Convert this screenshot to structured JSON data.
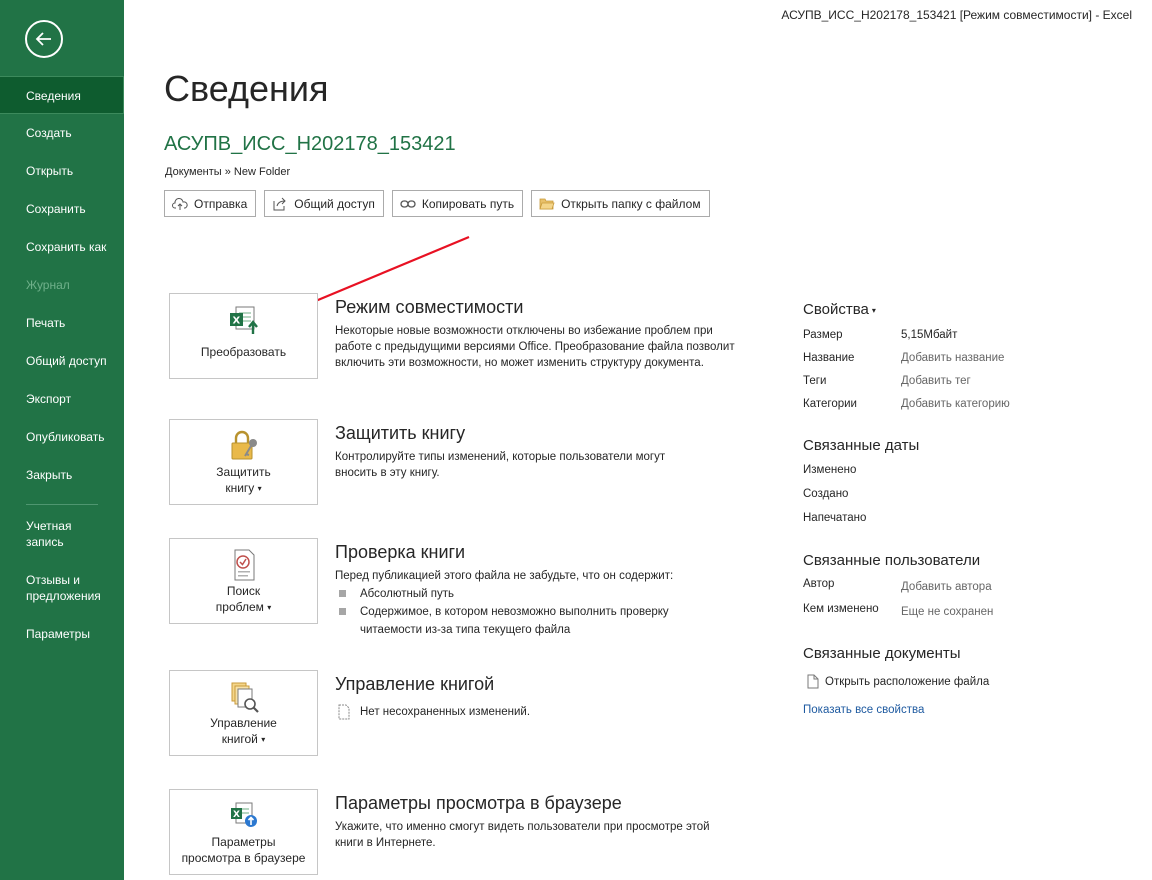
{
  "window": {
    "title": "АСУПВ_ИСС_Н202178_153421  [Режим совместимости]  -  Excel"
  },
  "sidebar": {
    "items": [
      {
        "label": "Сведения"
      },
      {
        "label": "Создать"
      },
      {
        "label": "Открыть"
      },
      {
        "label": "Сохранить"
      },
      {
        "label": "Сохранить как"
      },
      {
        "label": "Журнал"
      },
      {
        "label": "Печать"
      },
      {
        "label": "Общий доступ"
      },
      {
        "label": "Экспорт"
      },
      {
        "label": "Опубликовать"
      },
      {
        "label": "Закрыть"
      }
    ],
    "account": {
      "line1": "Учетная",
      "line2": "запись"
    },
    "feedback": {
      "line1": "Отзывы и",
      "line2": "предложения"
    },
    "options": "Параметры"
  },
  "header": {
    "title": "Сведения",
    "file_name": "АСУПВ_ИСС_Н202178_153421",
    "breadcrumb": "Документы » New Folder",
    "buttons": {
      "upload": "Отправка",
      "share": "Общий доступ",
      "copy_path": "Копировать путь",
      "open_folder": "Открыть папку с файлом"
    }
  },
  "sections": {
    "compat": {
      "button": "Преобразовать",
      "title": "Режим совместимости",
      "desc": "Некоторые новые возможности отключены во избежание проблем при работе с предыдущими версиями Office. Преобразование файла позволит включить эти возможности, но может изменить структуру документа."
    },
    "protect": {
      "button_line1": "Защитить",
      "button_line2": "книгу",
      "title": "Защитить книгу",
      "desc": "Контролируйте типы изменений, которые пользователи могут вносить в эту книгу."
    },
    "inspect": {
      "button_line1": "Поиск",
      "button_line2": "проблем",
      "title": "Проверка книги",
      "desc": "Перед публикацией этого файла не забудьте, что он содержит:",
      "bullets": [
        "Абсолютный путь",
        "Содержимое, в котором невозможно выполнить проверку читаемости из-за типа текущего файла"
      ]
    },
    "manage": {
      "button_line1": "Управление",
      "button_line2": "книгой",
      "title": "Управление книгой",
      "status": "Нет несохраненных изменений."
    },
    "browser": {
      "button_line1": "Параметры",
      "button_line2": "просмотра в браузере",
      "title": "Параметры просмотра в браузере",
      "desc": "Укажите, что именно смогут видеть пользователи при просмотре этой книги в Интернете."
    }
  },
  "properties": {
    "title": "Свойства",
    "rows": [
      {
        "label": "Размер",
        "value": "5,15Мбайт"
      },
      {
        "label": "Название",
        "value": "Добавить название"
      },
      {
        "label": "Теги",
        "value": "Добавить тег"
      },
      {
        "label": "Категории",
        "value": "Добавить категорию"
      }
    ],
    "dates_title": "Связанные даты",
    "dates": [
      "Изменено",
      "Создано",
      "Напечатано"
    ],
    "people_title": "Связанные пользователи",
    "people": [
      {
        "label": "Автор",
        "value": "Добавить автора"
      },
      {
        "label": "Кем изменено",
        "value": "Еще не сохранен"
      }
    ],
    "docs_title": "Связанные документы",
    "open_location": "Открыть расположение файла",
    "show_all": "Показать все свойства"
  },
  "colors": {
    "accent": "#217346",
    "arrow": "#e81123",
    "link": "#1e5aa0"
  }
}
